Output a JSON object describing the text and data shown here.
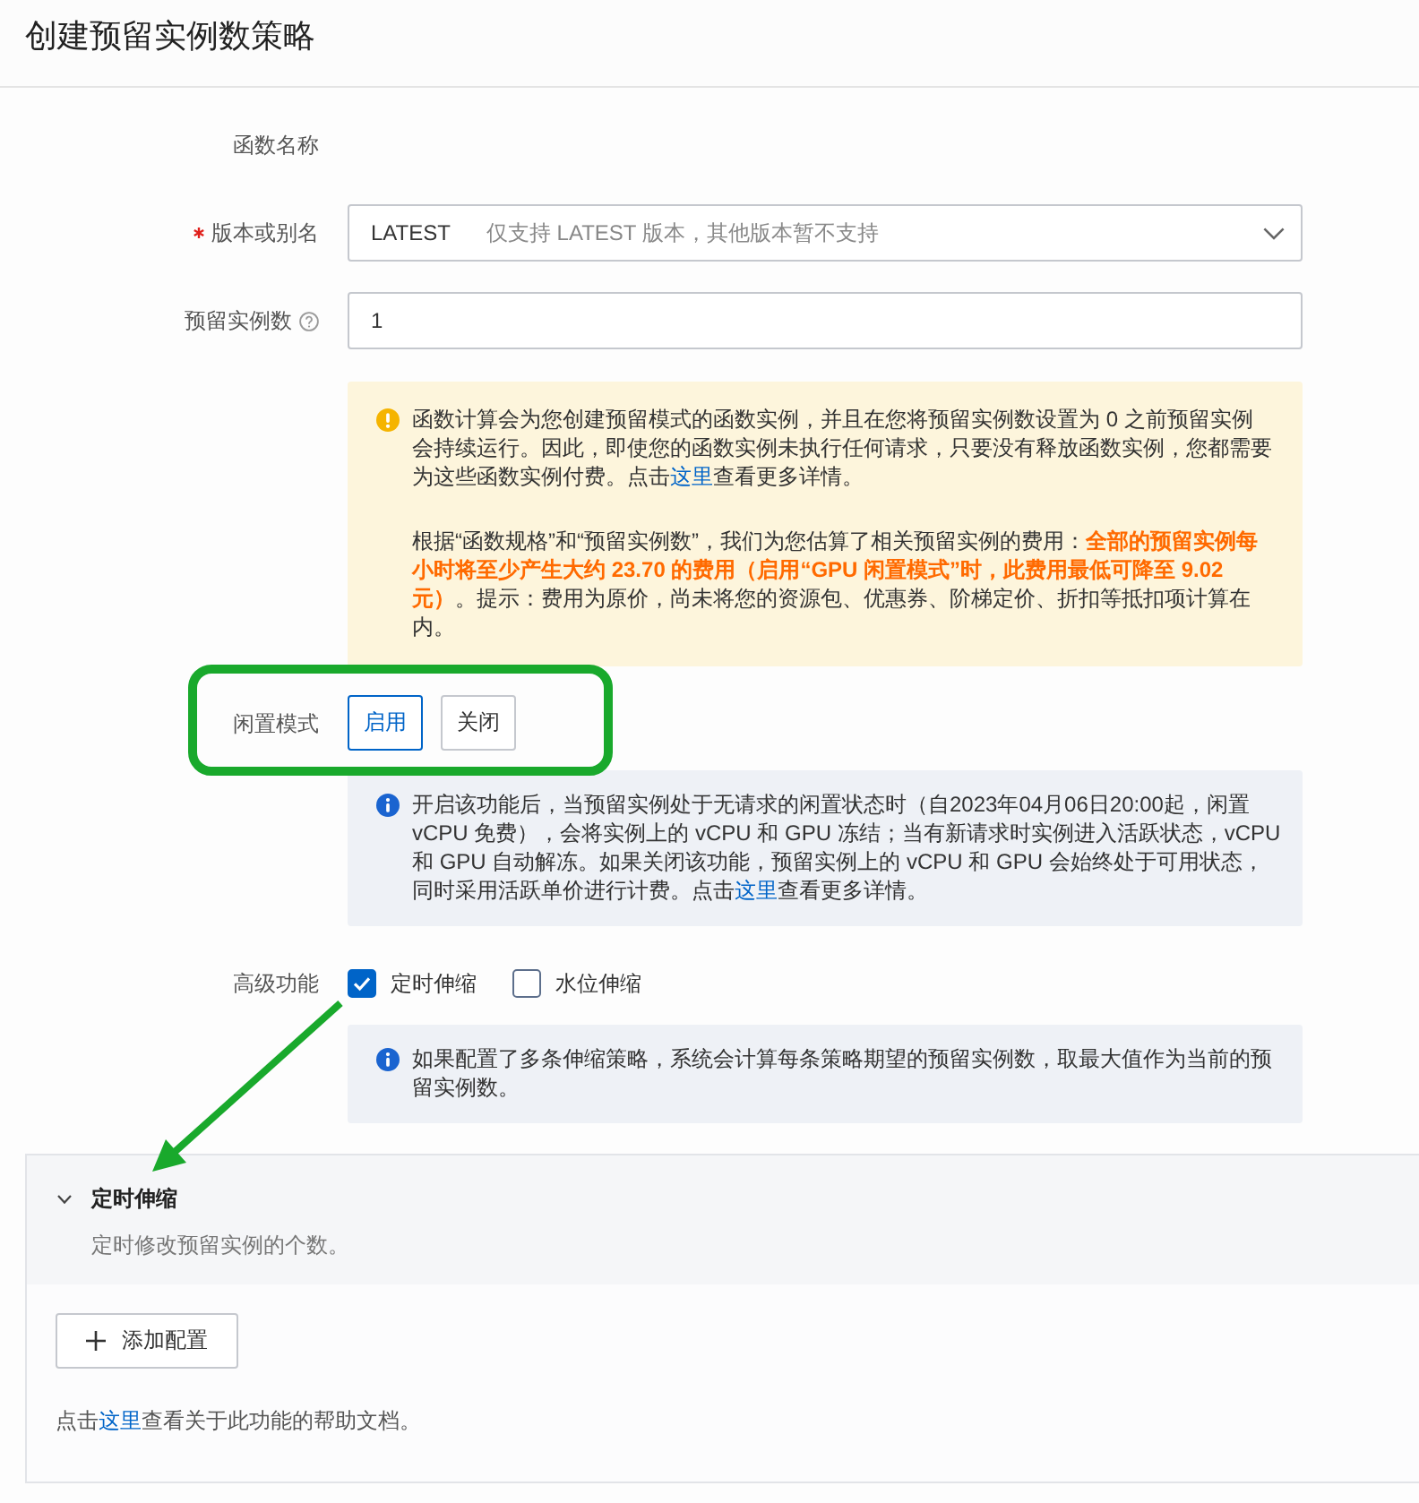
{
  "page": {
    "title": "创建预留实例数策略"
  },
  "form": {
    "function_name": {
      "label": "函数名称"
    },
    "version": {
      "label": "版本或别名",
      "required": true,
      "value": "LATEST",
      "hint": "仅支持 LATEST 版本，其他版本暂不支持"
    },
    "reserved_instances": {
      "label": "预留实例数",
      "value": "1"
    },
    "cost_notice": {
      "kind": "warning",
      "paragraphs": [
        [
          {
            "kind": "text",
            "text": "函数计算会为您创建预留模式的函数实例，并且在您将预留实例数设置为 0 之前预留实例会持续运行。因此，即使您的函数实例未执行任何请求，只要没有释放函数实例，您都需要为这些函数实例付费。点击"
          },
          {
            "kind": "link",
            "text": "这里"
          },
          {
            "kind": "text",
            "text": "查看更多详情。"
          }
        ],
        [
          {
            "kind": "text",
            "text": "根据“函数规格”和“预留实例数”，我们为您估算了相关预留实例的费用："
          },
          {
            "kind": "highlight",
            "text": "全部的预留实例每小时将至少产生大约 23.70 的费用（启用“GPU 闲置模式”时，此费用最低可降至 9.02 元）"
          },
          {
            "kind": "text",
            "text": "。提示：费用为原价，尚未将您的资源包、优惠券、阶梯定价、折扣等抵扣项计算在内。"
          }
        ]
      ]
    },
    "idle_mode": {
      "label": "闲置模式",
      "options": [
        {
          "label": "启用",
          "selected": true
        },
        {
          "label": "关闭",
          "selected": false
        }
      ],
      "note": {
        "kind": "info",
        "paragraphs": [
          [
            {
              "kind": "text",
              "text": "开启该功能后，当预留实例处于无请求的闲置状态时（自2023年04月06日20:00起，闲置 vCPU 免费），会将实例上的 vCPU 和 GPU 冻结；当有新请求时实例进入活跃状态，vCPU 和 GPU 自动解冻。如果关闭该功能，预留实例上的 vCPU 和 GPU 会始终处于可用状态，同时采用活跃单价进行计费。点击"
            },
            {
              "kind": "link",
              "text": "这里"
            },
            {
              "kind": "text",
              "text": "查看更多详情。"
            }
          ]
        ]
      }
    },
    "advanced": {
      "label": "高级功能",
      "options": [
        {
          "label": "定时伸缩",
          "checked": true
        },
        {
          "label": "水位伸缩",
          "checked": false
        }
      ],
      "note": {
        "kind": "info",
        "paragraphs": [
          [
            {
              "kind": "text",
              "text": "如果配置了多条伸缩策略，系统会计算每条策略期望的预留实例数，取最大值作为当前的预留实例数。"
            }
          ]
        ]
      }
    }
  },
  "scheduled_panel": {
    "title": "定时伸缩",
    "expanded": true,
    "description": "定时修改预留实例的个数。",
    "add_button": "添加配置",
    "help": [
      {
        "kind": "text",
        "text": "点击"
      },
      {
        "kind": "link",
        "text": "这里"
      },
      {
        "kind": "text",
        "text": "查看关于此功能的帮助文档。"
      }
    ]
  },
  "annotations": {
    "highlight_frame": true,
    "arrow": true
  }
}
